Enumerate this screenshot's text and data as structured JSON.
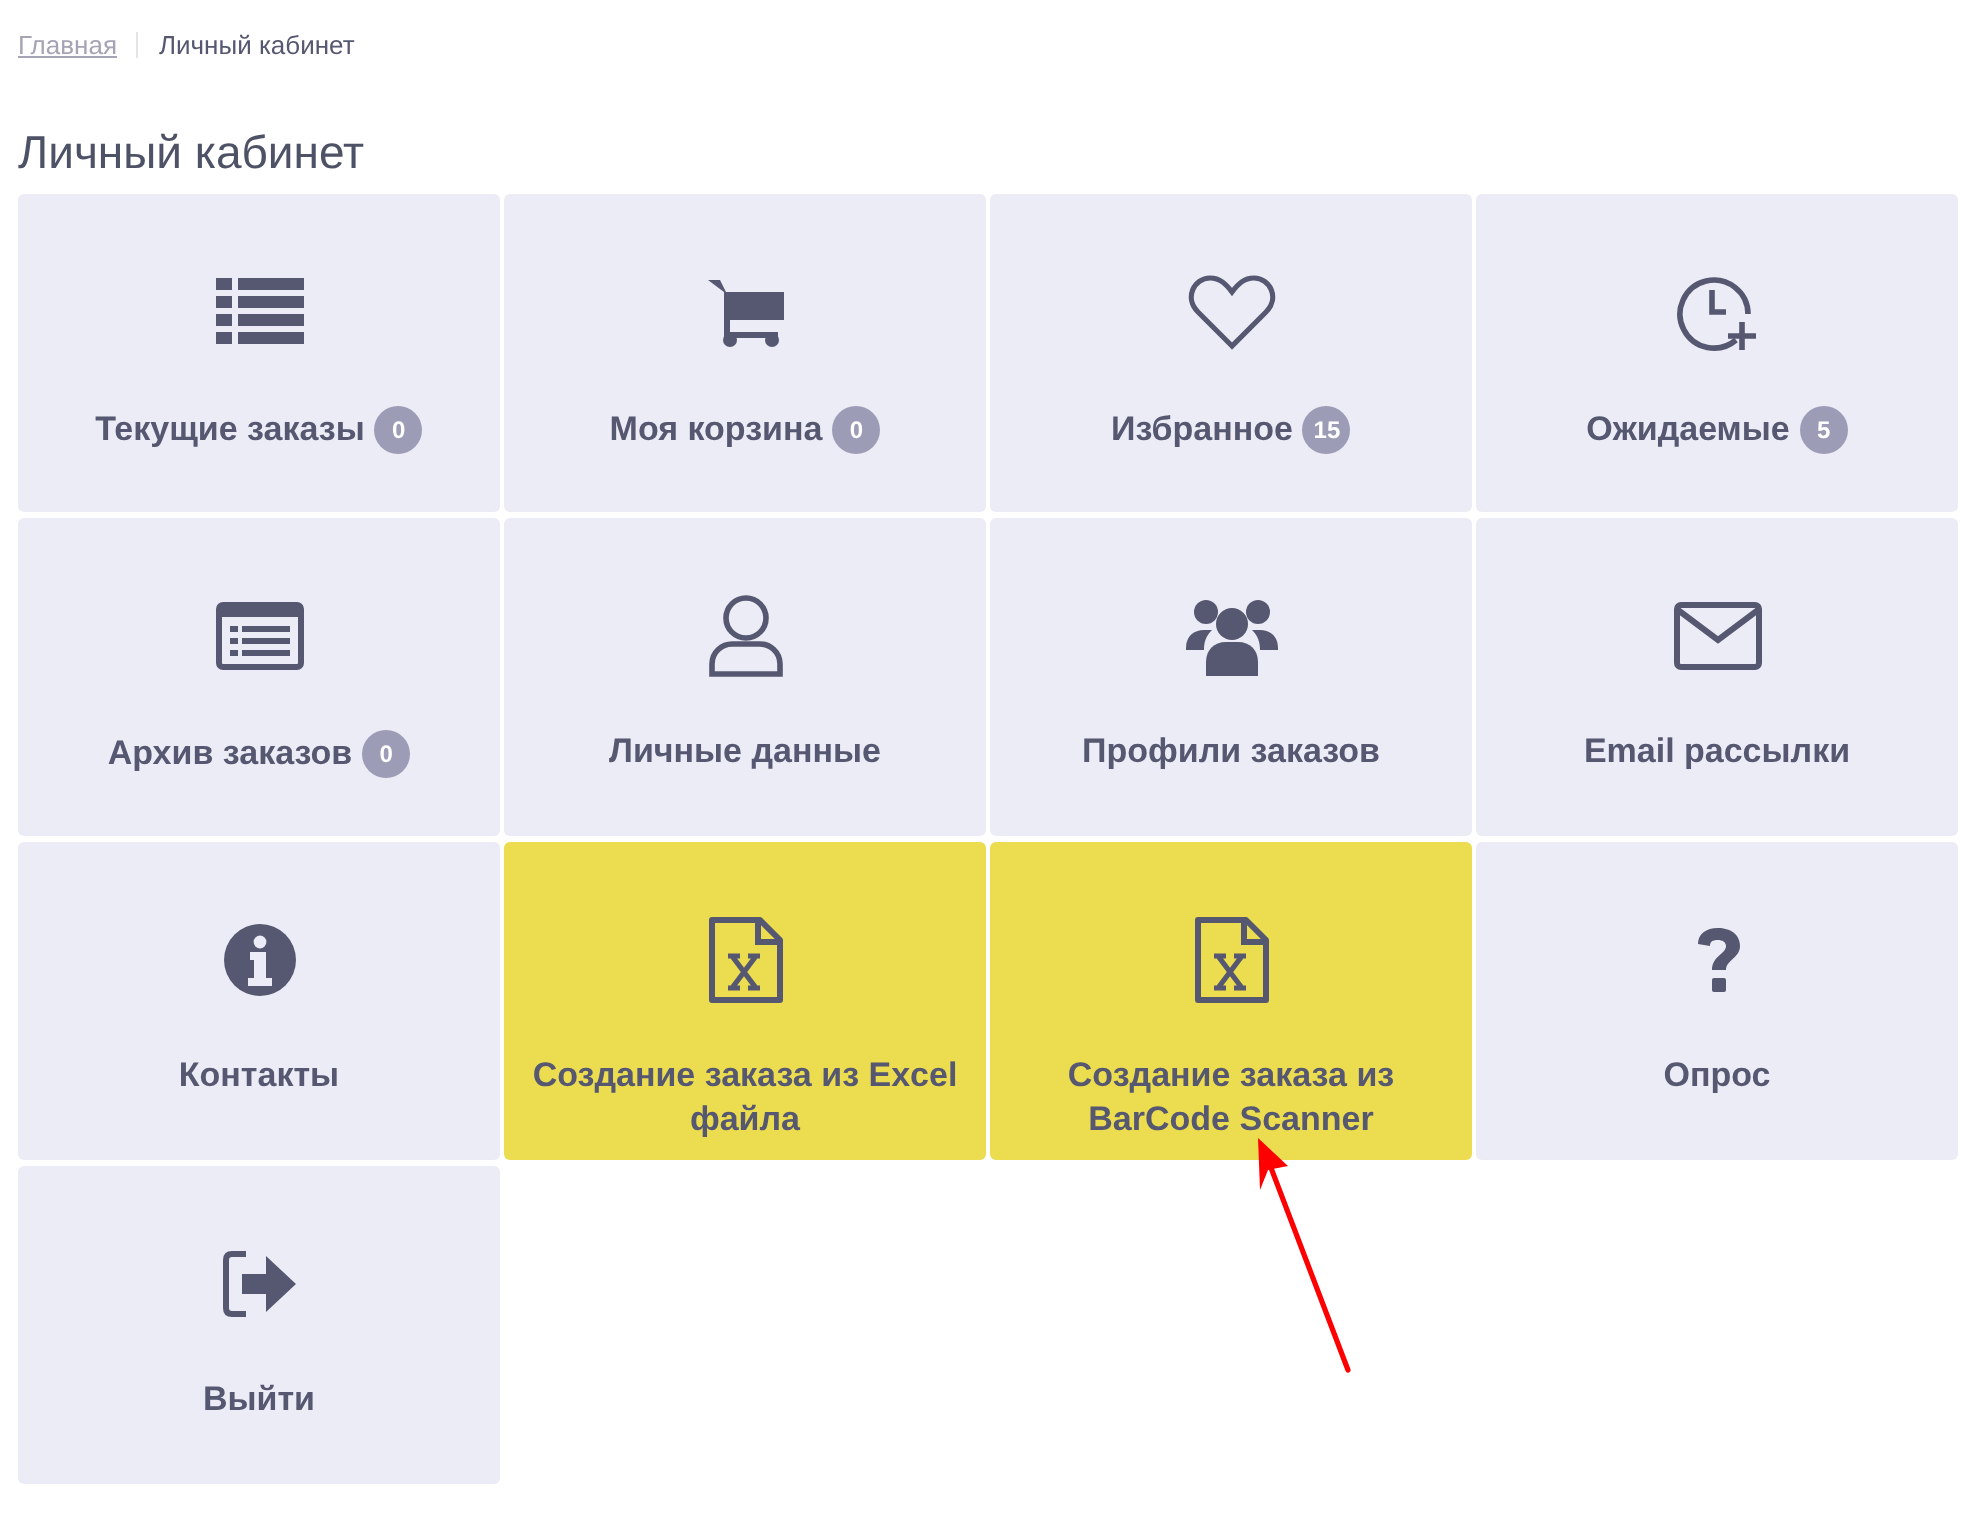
{
  "breadcrumbs": [
    {
      "label": "Главная",
      "link": true
    },
    {
      "label": "Личный кабинет",
      "link": false
    }
  ],
  "title": "Личный кабинет",
  "tiles": [
    {
      "kind": "list",
      "label": "Текущие заказы",
      "badge": "0",
      "highlighted": false
    },
    {
      "kind": "cart",
      "label": "Моя корзина",
      "badge": "0",
      "highlighted": false
    },
    {
      "kind": "heart",
      "label": "Избранное",
      "badge": "15",
      "highlighted": false
    },
    {
      "kind": "clock",
      "label": "Ожидаемые",
      "badge": "5",
      "highlighted": false
    },
    {
      "kind": "archive",
      "label": "Архив заказов",
      "badge": "0",
      "highlighted": false
    },
    {
      "kind": "user",
      "label": "Личные данные",
      "highlighted": false
    },
    {
      "kind": "users",
      "label": "Профили заказов",
      "highlighted": false
    },
    {
      "kind": "mail",
      "label": "Email рассылки",
      "highlighted": false
    },
    {
      "kind": "info",
      "label": "Контакты",
      "highlighted": false
    },
    {
      "kind": "excel",
      "label": "Создание заказа из Excel файла",
      "highlighted": true
    },
    {
      "kind": "excel",
      "label": "Создание заказа из BarCode Scanner",
      "highlighted": true
    },
    {
      "kind": "question",
      "label": "Опрос",
      "highlighted": false
    },
    {
      "kind": "logout",
      "label": "Выйти",
      "highlighted": false
    }
  ],
  "pointer_arrow": true
}
